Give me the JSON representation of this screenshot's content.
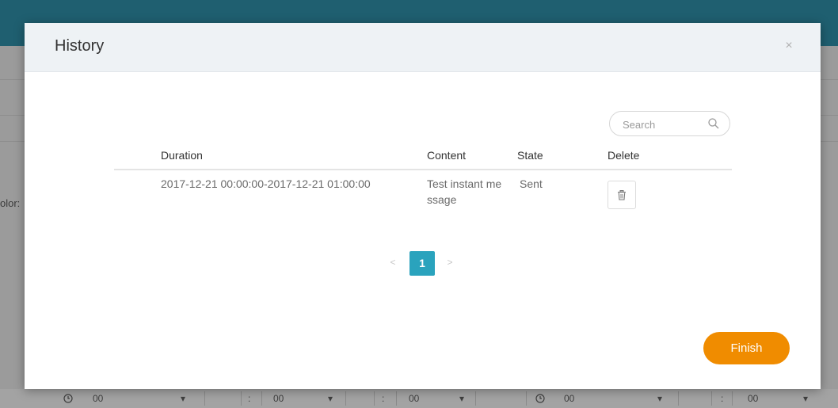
{
  "background": {
    "side_label": "olor:",
    "bottom_cells": [
      "00",
      "00",
      "00",
      "00",
      "00"
    ]
  },
  "modal": {
    "title": "History",
    "close_symbol": "×",
    "search": {
      "placeholder": "Search",
      "icon": "search-icon"
    },
    "table": {
      "headers": {
        "duration": "Duration",
        "content": "Content",
        "state": "State",
        "delete": "Delete"
      },
      "rows": [
        {
          "duration": "2017-12-21 00:00:00-2017-12-21 01:00:00",
          "content_line1": "Test instant me",
          "content_line2": "ssage",
          "state": "Sent",
          "delete_icon": "trash-icon"
        }
      ]
    },
    "pagination": {
      "prev": "<",
      "current": "1",
      "next": ">"
    },
    "finish_label": "Finish"
  },
  "colors": {
    "header_teal": "#1f5f70",
    "page_active": "#2aa3bd",
    "finish_orange": "#f08c00"
  }
}
